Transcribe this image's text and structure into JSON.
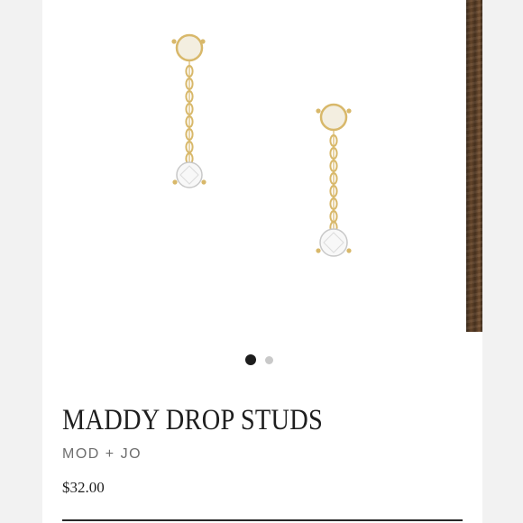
{
  "product": {
    "title": "MADDY DROP STUDS",
    "brand": "MOD + JO",
    "price": "$32.00"
  },
  "gallery": {
    "current_slide": 1,
    "total_slides": 2,
    "image_icon": "drop-stud-earrings"
  },
  "colors": {
    "gold": "#d8b86a",
    "pearl": "#f3eee0",
    "text": "#1e1e1e"
  }
}
